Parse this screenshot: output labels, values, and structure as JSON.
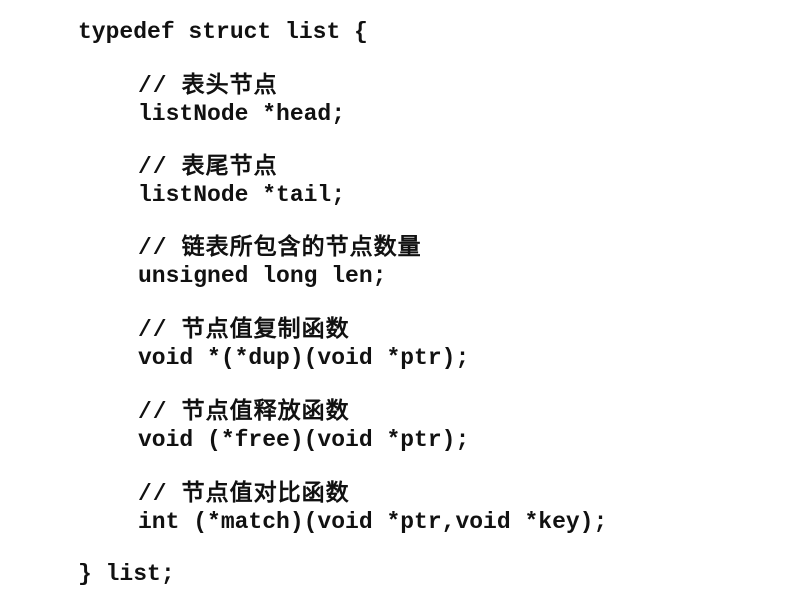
{
  "code": {
    "open_line": "typedef struct list {",
    "fields": [
      {
        "comment": "表头节点",
        "declaration": "listNode *head;"
      },
      {
        "comment": "表尾节点",
        "declaration": "listNode *tail;"
      },
      {
        "comment": "链表所包含的节点数量",
        "declaration": "unsigned long len;"
      },
      {
        "comment": "节点值复制函数",
        "declaration": "void *(*dup)(void *ptr);"
      },
      {
        "comment": "节点值释放函数",
        "declaration": "void (*free)(void *ptr);"
      },
      {
        "comment": "节点值对比函数",
        "declaration": "int (*match)(void *ptr,void *key);"
      }
    ],
    "comment_prefix": "//",
    "close_line": "} list;"
  }
}
